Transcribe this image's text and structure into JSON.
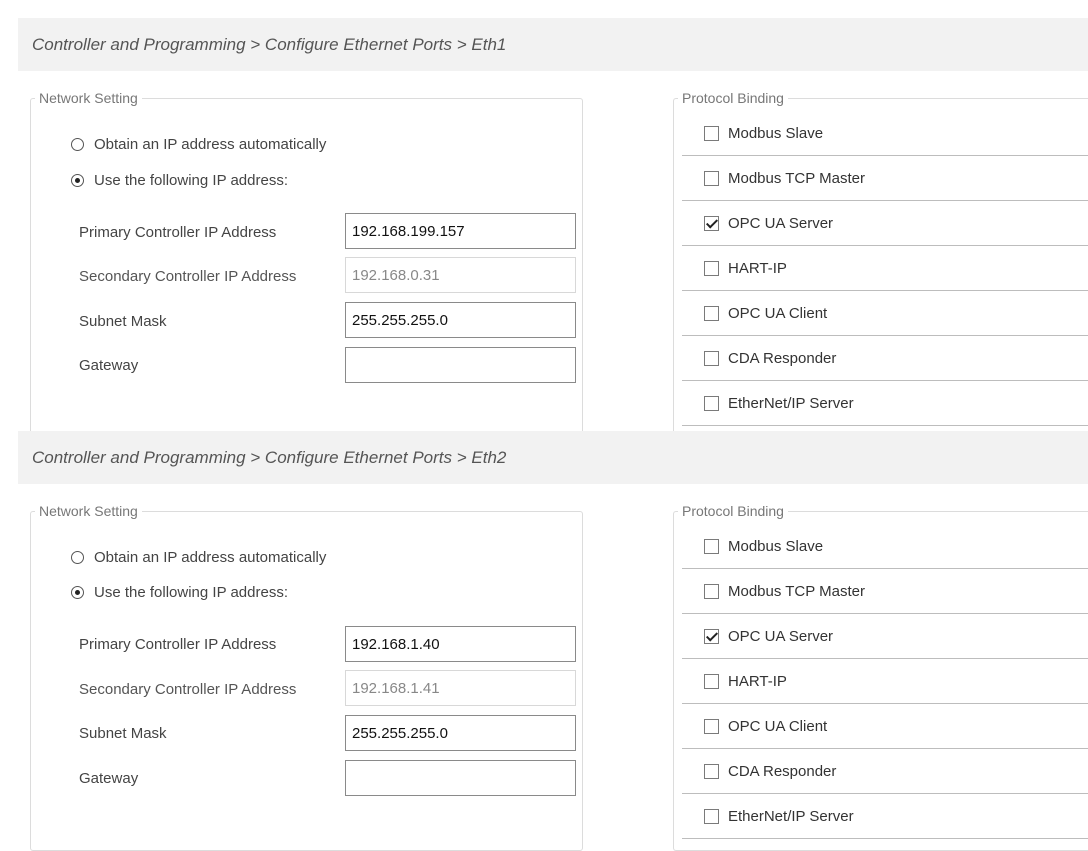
{
  "ports": [
    {
      "breadcrumb": "Controller and Programming > Configure Ethernet Ports > Eth1",
      "network": {
        "legend": "Network Setting",
        "radio_auto": "Obtain an IP address automatically",
        "radio_manual": "Use the following IP address:",
        "selected": "manual",
        "fields": [
          {
            "label": "Primary Controller IP Address",
            "value": "192.168.199.157",
            "enabled": true
          },
          {
            "label": "Secondary Controller IP Address",
            "value": "192.168.0.31",
            "enabled": false
          },
          {
            "label": "Subnet Mask",
            "value": "255.255.255.0",
            "enabled": true
          },
          {
            "label": "Gateway",
            "value": "",
            "enabled": true
          }
        ]
      },
      "protocol": {
        "legend": "Protocol Binding",
        "items": [
          {
            "label": "Modbus Slave",
            "checked": false
          },
          {
            "label": "Modbus TCP Master",
            "checked": false
          },
          {
            "label": "OPC UA Server",
            "checked": true
          },
          {
            "label": "HART-IP",
            "checked": false
          },
          {
            "label": "OPC UA Client",
            "checked": false
          },
          {
            "label": "CDA Responder",
            "checked": false
          },
          {
            "label": "EtherNet/IP Server",
            "checked": false
          }
        ]
      }
    },
    {
      "breadcrumb": "Controller and Programming > Configure Ethernet Ports > Eth2",
      "network": {
        "legend": "Network Setting",
        "radio_auto": "Obtain an IP address automatically",
        "radio_manual": "Use the following IP address:",
        "selected": "manual",
        "fields": [
          {
            "label": "Primary Controller IP Address",
            "value": "192.168.1.40",
            "enabled": true
          },
          {
            "label": "Secondary Controller IP Address",
            "value": "192.168.1.41",
            "enabled": false
          },
          {
            "label": "Subnet Mask",
            "value": "255.255.255.0",
            "enabled": true
          },
          {
            "label": "Gateway",
            "value": "",
            "enabled": true
          }
        ]
      },
      "protocol": {
        "legend": "Protocol Binding",
        "items": [
          {
            "label": "Modbus Slave",
            "checked": false
          },
          {
            "label": "Modbus TCP Master",
            "checked": false
          },
          {
            "label": "OPC UA Server",
            "checked": true
          },
          {
            "label": "HART-IP",
            "checked": false
          },
          {
            "label": "OPC UA Client",
            "checked": false
          },
          {
            "label": "CDA Responder",
            "checked": false
          },
          {
            "label": "EtherNet/IP Server",
            "checked": false
          }
        ]
      }
    }
  ]
}
